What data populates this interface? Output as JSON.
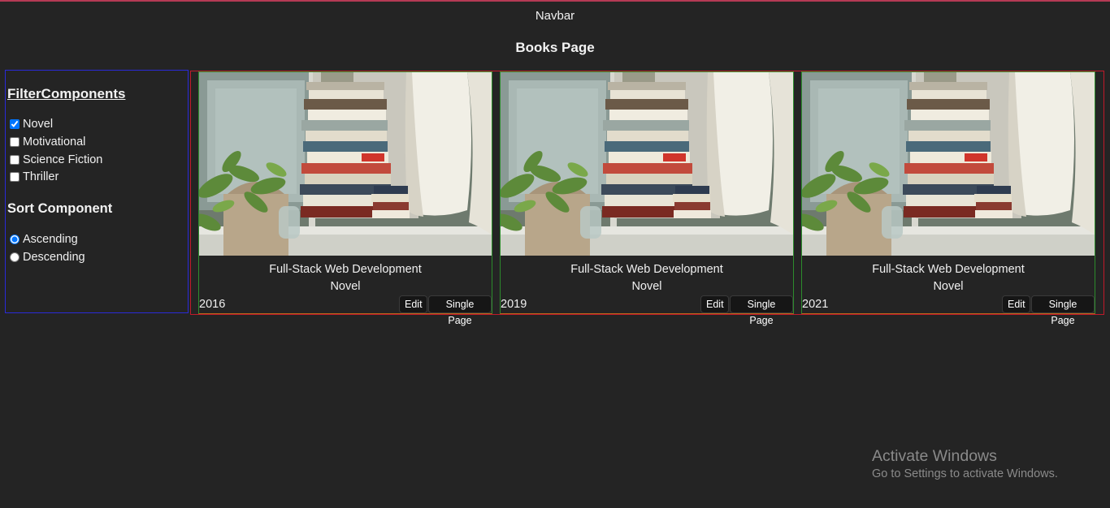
{
  "navbar": {
    "label": "Navbar"
  },
  "page": {
    "title": "Books Page"
  },
  "filter": {
    "heading": "FilterComponents",
    "options": [
      {
        "label": "Novel",
        "checked": true
      },
      {
        "label": "Motivational",
        "checked": false
      },
      {
        "label": "Science Fiction",
        "checked": false
      },
      {
        "label": "Thriller",
        "checked": false
      }
    ]
  },
  "sort": {
    "heading": "Sort Component",
    "options": [
      {
        "label": "Ascending",
        "selected": true
      },
      {
        "label": "Descending",
        "selected": false
      }
    ]
  },
  "books": [
    {
      "title": "Full-Stack Web Development",
      "genre": "Novel",
      "year": "2016",
      "edit_label": "Edit",
      "single_label": "Single Page"
    },
    {
      "title": "Full-Stack Web Development",
      "genre": "Novel",
      "year": "2019",
      "edit_label": "Edit",
      "single_label": "Single Page"
    },
    {
      "title": "Full-Stack Web Development",
      "genre": "Novel",
      "year": "2021",
      "edit_label": "Edit",
      "single_label": "Single Page"
    }
  ],
  "watermark": {
    "title": "Activate Windows",
    "subtitle": "Go to Settings to activate Windows."
  },
  "colors": {
    "background": "#242424",
    "filter_border": "#2a2ad8",
    "books_border": "#c01a2a",
    "card_border": "#2c8c2c",
    "top_line": "#b53a55"
  }
}
